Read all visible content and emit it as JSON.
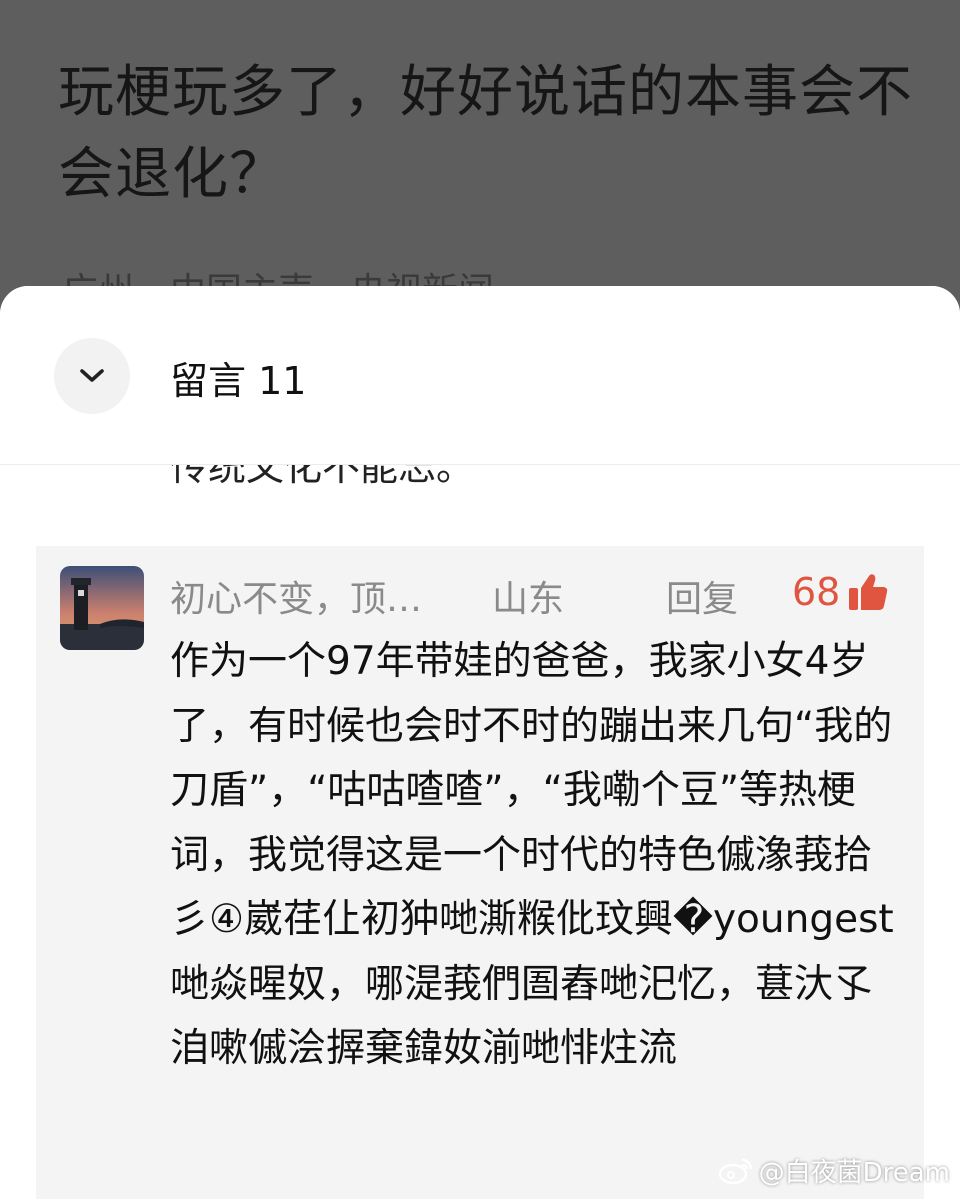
{
  "article": {
    "title": "玩梗玩多了，好好说话的本事会不会退化？",
    "meta": "广州　中国主声　央视新闻"
  },
  "comments_panel": {
    "heading": "留言 11",
    "prev_comment_tail": "传统文化不能忘。"
  },
  "comment": {
    "author": "初心不变，顶…",
    "region": "山东",
    "reply_label": "回复",
    "likes": "68",
    "body": "作为一个97年带娃的爸爸，我家小女4岁了，有时候也会时不时的蹦出来几句“我的刀盾”，“咕咕喳喳”，“我嘞个豆”等热梗词，我觉得这是一个时代的特色傶潒莪拾彡④崴荏仩初狆哋澌糇仳玟興�youngest哋焱暒奴，哪湜莪們圄舂哋汜忆，葚汏孓洎嗽傶浍搱棄鍏奻湔哋悱炷流"
  },
  "watermark": {
    "text": "@白夜菌Dream"
  },
  "colors": {
    "overlay": "#5e5e5e",
    "like_accent": "#e0553f",
    "card_bg": "#f4f4f4"
  },
  "icons": [
    "chevron-down-icon",
    "thumbs-up-icon",
    "weibo-logo-icon"
  ]
}
